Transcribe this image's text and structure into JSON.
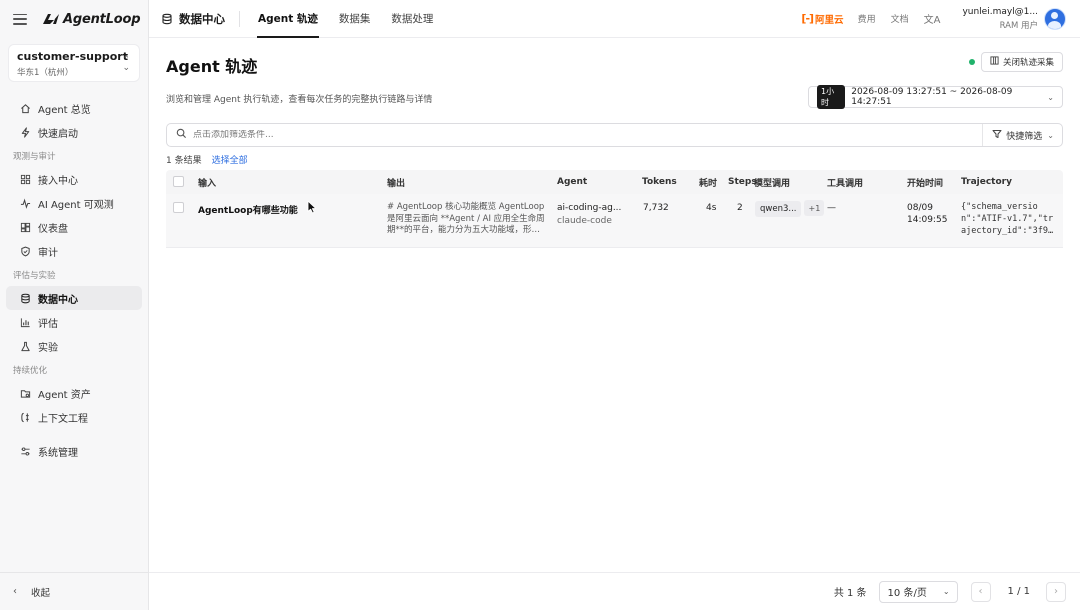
{
  "app": {
    "logo_text": "AgentLoop"
  },
  "tenant": {
    "name": "customer-support",
    "region": "华东1（杭州）"
  },
  "sidebar": {
    "items_top": [
      {
        "label": "Agent 总览",
        "icon": "home-icon"
      },
      {
        "label": "快速启动",
        "icon": "bolt-icon"
      }
    ],
    "group_observe": "观测与审计",
    "items_observe": [
      {
        "label": "接入中心",
        "icon": "grid-icon"
      },
      {
        "label": "AI Agent 可观测",
        "icon": "pulse-icon"
      },
      {
        "label": "仪表盘",
        "icon": "dashboard-icon"
      },
      {
        "label": "审计",
        "icon": "shield-icon"
      }
    ],
    "group_eval": "评估与实验",
    "items_eval": [
      {
        "label": "数据中心",
        "icon": "database-icon",
        "active": true
      },
      {
        "label": "评估",
        "icon": "bar-chart-icon"
      },
      {
        "label": "实验",
        "icon": "flask-icon"
      }
    ],
    "group_optimize": "持续优化",
    "items_optimize": [
      {
        "label": "Agent 资产",
        "icon": "folder-icon"
      },
      {
        "label": "上下文工程",
        "icon": "context-icon"
      }
    ],
    "item_system": {
      "label": "系统管理",
      "icon": "settings-icon"
    },
    "collapse_label": "收起"
  },
  "header": {
    "section_title": "数据中心",
    "tabs": [
      {
        "label": "Agent 轨迹",
        "active": true
      },
      {
        "label": "数据集",
        "active": false
      },
      {
        "label": "数据处理",
        "active": false
      }
    ],
    "brand": "阿里云",
    "links": [
      "费用",
      "文档"
    ],
    "user_name": "yunlei.mayl@1...",
    "user_role": "RAM 用户"
  },
  "page": {
    "title": "Agent 轨迹",
    "description": "浏览和管理 Agent 执行轨迹，查看每次任务的完整执行链路与详情",
    "close_collect_label": "关闭轨迹采集",
    "time_badge": "1小时",
    "time_range": "2026-08-09 13:27:51 ~ 2026-08-09 14:27:51",
    "filter_placeholder": "点击添加筛选条件...",
    "quick_filter_label": "快捷筛选",
    "result_count": "1 条结果",
    "select_all": "选择全部"
  },
  "table": {
    "columns": {
      "input": "输入",
      "output": "输出",
      "agent": "Agent",
      "tokens": "Tokens",
      "duration": "耗时",
      "steps": "Steps",
      "model_calls": "模型调用",
      "tool_calls": "工具调用",
      "start_time": "开始时间",
      "trajectory": "Trajectory"
    },
    "rows": [
      {
        "input": "AgentLoop有哪些功能",
        "output": "# AgentLoop 核心功能概览 AgentLoop 是阿里云面向 **Agent / AI 应用全生命周期**的平台，能力分为五大功能域，形…",
        "agent": "ai-coding-ag...",
        "agent_sub": "claude-code",
        "tokens": "7,732",
        "duration": "4s",
        "steps": "2",
        "model": "qwen3...",
        "model_more": "+1",
        "tool_calls": "—",
        "start_date": "08/09",
        "start_time": "14:09:55",
        "trajectory": "{\"schema_version\":\"ATIF-v1.7\",\"trajectory_id\":\"3f9…"
      }
    ]
  },
  "footer": {
    "total": "共 1 条",
    "page_size": "10 条/页",
    "page_indicator": "1 / 1"
  },
  "colors": {
    "accent": "#2f6fe0",
    "brand": "#ff6a00",
    "status_ok": "#20b26b"
  }
}
